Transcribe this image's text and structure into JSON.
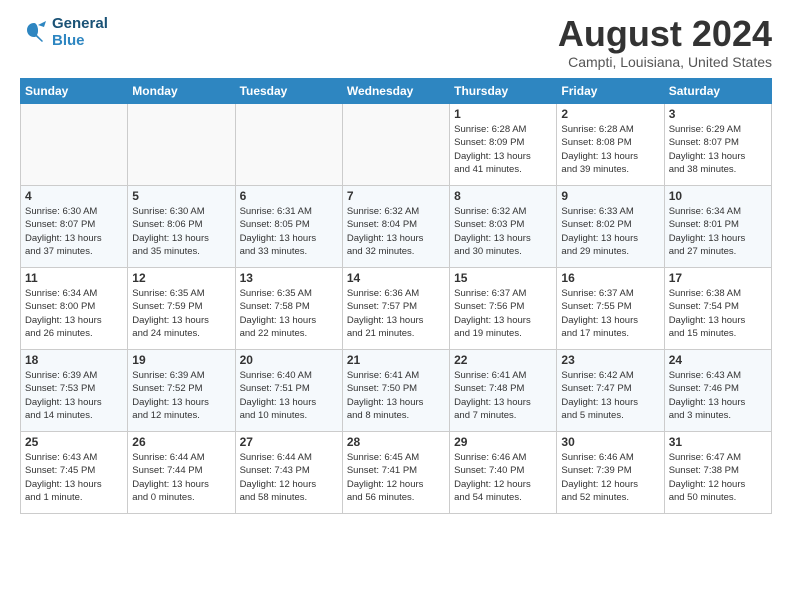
{
  "header": {
    "logo_line1": "General",
    "logo_line2": "Blue",
    "month": "August 2024",
    "location": "Campti, Louisiana, United States"
  },
  "weekdays": [
    "Sunday",
    "Monday",
    "Tuesday",
    "Wednesday",
    "Thursday",
    "Friday",
    "Saturday"
  ],
  "weeks": [
    [
      {
        "day": "",
        "info": ""
      },
      {
        "day": "",
        "info": ""
      },
      {
        "day": "",
        "info": ""
      },
      {
        "day": "",
        "info": ""
      },
      {
        "day": "1",
        "info": "Sunrise: 6:28 AM\nSunset: 8:09 PM\nDaylight: 13 hours\nand 41 minutes."
      },
      {
        "day": "2",
        "info": "Sunrise: 6:28 AM\nSunset: 8:08 PM\nDaylight: 13 hours\nand 39 minutes."
      },
      {
        "day": "3",
        "info": "Sunrise: 6:29 AM\nSunset: 8:07 PM\nDaylight: 13 hours\nand 38 minutes."
      }
    ],
    [
      {
        "day": "4",
        "info": "Sunrise: 6:30 AM\nSunset: 8:07 PM\nDaylight: 13 hours\nand 37 minutes."
      },
      {
        "day": "5",
        "info": "Sunrise: 6:30 AM\nSunset: 8:06 PM\nDaylight: 13 hours\nand 35 minutes."
      },
      {
        "day": "6",
        "info": "Sunrise: 6:31 AM\nSunset: 8:05 PM\nDaylight: 13 hours\nand 33 minutes."
      },
      {
        "day": "7",
        "info": "Sunrise: 6:32 AM\nSunset: 8:04 PM\nDaylight: 13 hours\nand 32 minutes."
      },
      {
        "day": "8",
        "info": "Sunrise: 6:32 AM\nSunset: 8:03 PM\nDaylight: 13 hours\nand 30 minutes."
      },
      {
        "day": "9",
        "info": "Sunrise: 6:33 AM\nSunset: 8:02 PM\nDaylight: 13 hours\nand 29 minutes."
      },
      {
        "day": "10",
        "info": "Sunrise: 6:34 AM\nSunset: 8:01 PM\nDaylight: 13 hours\nand 27 minutes."
      }
    ],
    [
      {
        "day": "11",
        "info": "Sunrise: 6:34 AM\nSunset: 8:00 PM\nDaylight: 13 hours\nand 26 minutes."
      },
      {
        "day": "12",
        "info": "Sunrise: 6:35 AM\nSunset: 7:59 PM\nDaylight: 13 hours\nand 24 minutes."
      },
      {
        "day": "13",
        "info": "Sunrise: 6:35 AM\nSunset: 7:58 PM\nDaylight: 13 hours\nand 22 minutes."
      },
      {
        "day": "14",
        "info": "Sunrise: 6:36 AM\nSunset: 7:57 PM\nDaylight: 13 hours\nand 21 minutes."
      },
      {
        "day": "15",
        "info": "Sunrise: 6:37 AM\nSunset: 7:56 PM\nDaylight: 13 hours\nand 19 minutes."
      },
      {
        "day": "16",
        "info": "Sunrise: 6:37 AM\nSunset: 7:55 PM\nDaylight: 13 hours\nand 17 minutes."
      },
      {
        "day": "17",
        "info": "Sunrise: 6:38 AM\nSunset: 7:54 PM\nDaylight: 13 hours\nand 15 minutes."
      }
    ],
    [
      {
        "day": "18",
        "info": "Sunrise: 6:39 AM\nSunset: 7:53 PM\nDaylight: 13 hours\nand 14 minutes."
      },
      {
        "day": "19",
        "info": "Sunrise: 6:39 AM\nSunset: 7:52 PM\nDaylight: 13 hours\nand 12 minutes."
      },
      {
        "day": "20",
        "info": "Sunrise: 6:40 AM\nSunset: 7:51 PM\nDaylight: 13 hours\nand 10 minutes."
      },
      {
        "day": "21",
        "info": "Sunrise: 6:41 AM\nSunset: 7:50 PM\nDaylight: 13 hours\nand 8 minutes."
      },
      {
        "day": "22",
        "info": "Sunrise: 6:41 AM\nSunset: 7:48 PM\nDaylight: 13 hours\nand 7 minutes."
      },
      {
        "day": "23",
        "info": "Sunrise: 6:42 AM\nSunset: 7:47 PM\nDaylight: 13 hours\nand 5 minutes."
      },
      {
        "day": "24",
        "info": "Sunrise: 6:43 AM\nSunset: 7:46 PM\nDaylight: 13 hours\nand 3 minutes."
      }
    ],
    [
      {
        "day": "25",
        "info": "Sunrise: 6:43 AM\nSunset: 7:45 PM\nDaylight: 13 hours\nand 1 minute."
      },
      {
        "day": "26",
        "info": "Sunrise: 6:44 AM\nSunset: 7:44 PM\nDaylight: 13 hours\nand 0 minutes."
      },
      {
        "day": "27",
        "info": "Sunrise: 6:44 AM\nSunset: 7:43 PM\nDaylight: 12 hours\nand 58 minutes."
      },
      {
        "day": "28",
        "info": "Sunrise: 6:45 AM\nSunset: 7:41 PM\nDaylight: 12 hours\nand 56 minutes."
      },
      {
        "day": "29",
        "info": "Sunrise: 6:46 AM\nSunset: 7:40 PM\nDaylight: 12 hours\nand 54 minutes."
      },
      {
        "day": "30",
        "info": "Sunrise: 6:46 AM\nSunset: 7:39 PM\nDaylight: 12 hours\nand 52 minutes."
      },
      {
        "day": "31",
        "info": "Sunrise: 6:47 AM\nSunset: 7:38 PM\nDaylight: 12 hours\nand 50 minutes."
      }
    ]
  ]
}
